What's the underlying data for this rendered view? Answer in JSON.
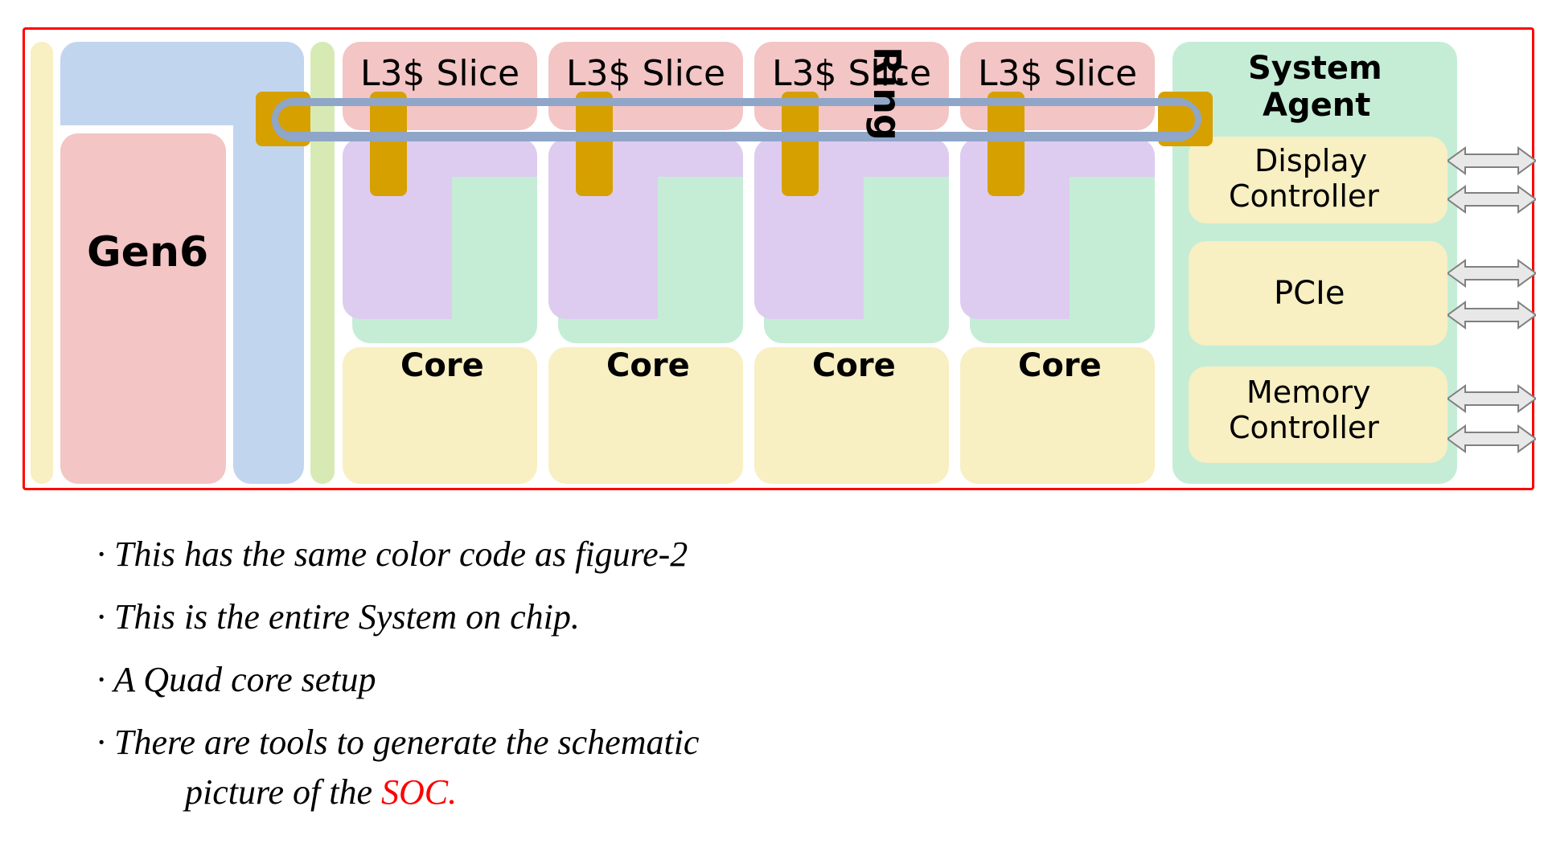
{
  "diagram": {
    "gpu_label": "Gen6",
    "l3_slice_label": "L3$ Slice",
    "core_label": "Core",
    "ring_label": "Ring",
    "system_agent": {
      "title": "System Agent",
      "display_controller": "Display\nController",
      "pcie": "PCIe",
      "memory_controller": "Memory\nController"
    },
    "colors": {
      "pink": "#f3c5c5",
      "blue": "#c2d5ef",
      "yellowgreen": "#d7eab4",
      "mint": "#c5edd6",
      "lavender": "#ddccf0",
      "cream": "#f8efc2",
      "gold": "#d6a000",
      "ring_stroke": "#8fa6c9",
      "arrow_fill": "#e8e8e8",
      "arrow_stroke": "#808080"
    }
  },
  "notes": {
    "l1": "· This has the same color code as figure-2",
    "l2": "· This is the entire System on chip.",
    "l3": "· A Quad core setup",
    "l4a": "· There are tools to generate the schematic",
    "l4b_black": "picture of the ",
    "l4b_red": "SOC."
  }
}
